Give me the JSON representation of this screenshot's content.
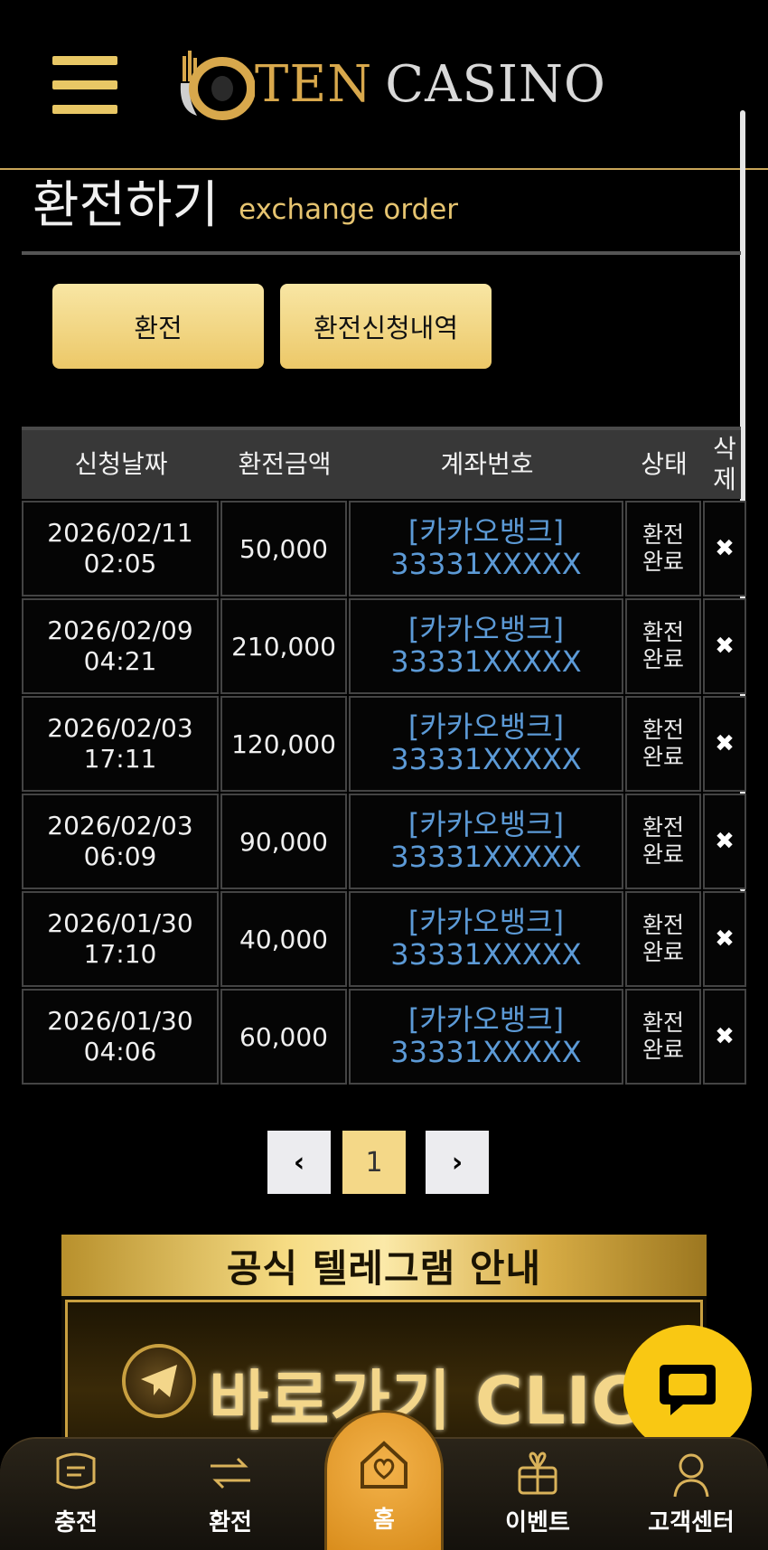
{
  "header": {
    "logo_ten": "TEN",
    "logo_casino": "CASINO"
  },
  "page": {
    "title_ko": "환전하기",
    "title_en": "exchange order"
  },
  "tabs": [
    {
      "label": "환전"
    },
    {
      "label": "환전신청내역"
    }
  ],
  "table": {
    "headers": {
      "date": "신청날짜",
      "amount": "환전금액",
      "account": "계좌번호",
      "status": "상태",
      "delete_line1": "삭",
      "delete_line2": "제"
    },
    "rows": [
      {
        "date": "2026/02/11",
        "time": "02:05",
        "amount": "50,000",
        "bank": "[카카오뱅크]",
        "account": "33331XXXXX",
        "status1": "환전",
        "status2": "완료",
        "delete": "✖"
      },
      {
        "date": "2026/02/09",
        "time": "04:21",
        "amount": "210,000",
        "bank": "[카카오뱅크]",
        "account": "33331XXXXX",
        "status1": "환전",
        "status2": "완료",
        "delete": "✖"
      },
      {
        "date": "2026/02/03",
        "time": "17:11",
        "amount": "120,000",
        "bank": "[카카오뱅크]",
        "account": "33331XXXXX",
        "status1": "환전",
        "status2": "완료",
        "delete": "✖"
      },
      {
        "date": "2026/02/03",
        "time": "06:09",
        "amount": "90,000",
        "bank": "[카카오뱅크]",
        "account": "33331XXXXX",
        "status1": "환전",
        "status2": "완료",
        "delete": "✖"
      },
      {
        "date": "2026/01/30",
        "time": "17:10",
        "amount": "40,000",
        "bank": "[카카오뱅크]",
        "account": "33331XXXXX",
        "status1": "환전",
        "status2": "완료",
        "delete": "✖"
      },
      {
        "date": "2026/01/30",
        "time": "04:06",
        "amount": "60,000",
        "bank": "[카카오뱅크]",
        "account": "33331XXXXX",
        "status1": "환전",
        "status2": "완료",
        "delete": "✖"
      }
    ]
  },
  "pagination": {
    "prev": "‹",
    "current": "1",
    "next": "›"
  },
  "banner": {
    "top_text": "공식 텔레그램 안내",
    "cta_text": "바로가기 CLICK"
  },
  "bottom_nav": {
    "charge": "충전",
    "exchange": "환전",
    "home": "홈",
    "event": "이벤트",
    "support": "고객센터"
  },
  "colors": {
    "accent_gold": "#e8c765",
    "link_blue": "#5c9ad6",
    "chat_yellow": "#f9c813"
  },
  "icons": [
    "menu-icon",
    "chat-icon",
    "charge-icon",
    "exchange-icon",
    "home-icon",
    "gift-icon",
    "support-icon",
    "telegram-icon"
  ]
}
